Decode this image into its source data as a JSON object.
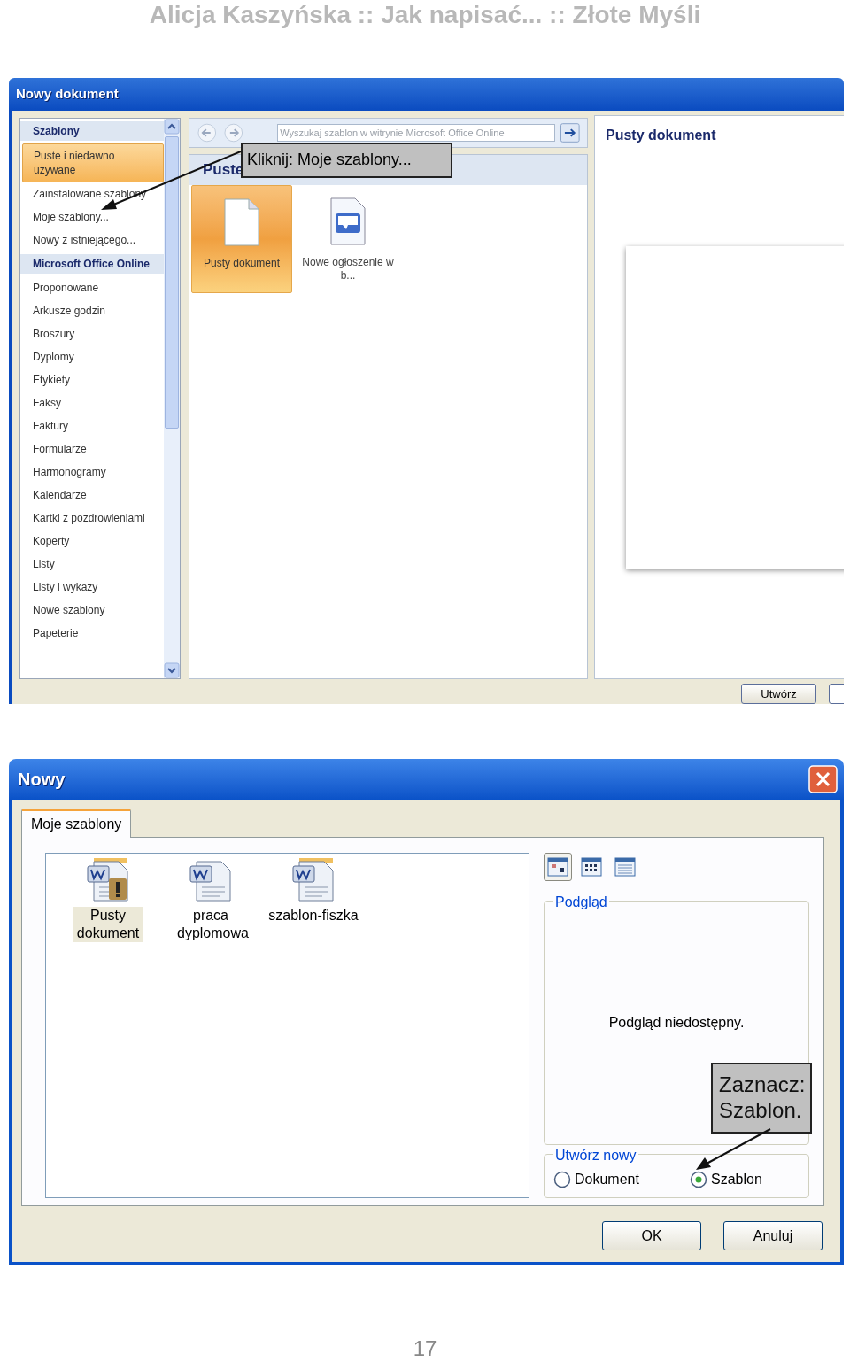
{
  "page_header": "Alicja Kaszyńska :: Jak napisać... :: Złote Myśli",
  "screenshot_1": {
    "window": {
      "title": "Nowy dokument"
    },
    "sidebar": {
      "items": [
        {
          "label": "Szablony",
          "kind": "header"
        },
        {
          "label": "Puste i niedawno używane",
          "kind": "item",
          "selected": true
        },
        {
          "label": "Zainstalowane szablony",
          "kind": "item",
          "selected": false
        },
        {
          "label": "Moje szablony...",
          "kind": "item",
          "selected": false
        },
        {
          "label": "Nowy z istniejącego...",
          "kind": "item",
          "selected": false
        },
        {
          "label": "Microsoft Office Online",
          "kind": "header"
        },
        {
          "label": "Proponowane",
          "kind": "item",
          "selected": false
        },
        {
          "label": "Arkusze godzin",
          "kind": "item",
          "selected": false
        },
        {
          "label": "Broszury",
          "kind": "item",
          "selected": false
        },
        {
          "label": "Dyplomy",
          "kind": "item",
          "selected": false
        },
        {
          "label": "Etykiety",
          "kind": "item",
          "selected": false
        },
        {
          "label": "Faksy",
          "kind": "item",
          "selected": false
        },
        {
          "label": "Faktury",
          "kind": "item",
          "selected": false
        },
        {
          "label": "Formularze",
          "kind": "item",
          "selected": false
        },
        {
          "label": "Harmonogramy",
          "kind": "item",
          "selected": false
        },
        {
          "label": "Kalendarze",
          "kind": "item",
          "selected": false
        },
        {
          "label": "Kartki z pozdrowieniami",
          "kind": "item",
          "selected": false
        },
        {
          "label": "Koperty",
          "kind": "item",
          "selected": false
        },
        {
          "label": "Listy",
          "kind": "item",
          "selected": false
        },
        {
          "label": "Listy i wykazy",
          "kind": "item",
          "selected": false
        },
        {
          "label": "Nowe szablony",
          "kind": "item",
          "selected": false
        },
        {
          "label": "Papeterie",
          "kind": "item",
          "selected": false
        }
      ]
    },
    "search": {
      "placeholder": "Wyszukaj szablon w witrynie Microsoft Office Online"
    },
    "section_title": "Puste",
    "templates": [
      {
        "label": "Pusty dokument",
        "kind": "blank",
        "selected": true
      },
      {
        "label": "Nowe ogłoszenie w b...",
        "kind": "announcement",
        "selected": false
      }
    ],
    "preview": {
      "title": "Pusty dokument"
    },
    "buttons": [
      "Utwórz"
    ],
    "callout": "Kliknij: Moje szablony..."
  },
  "screenshot_2": {
    "window": {
      "title": "Nowy"
    },
    "tabs": [
      {
        "label": "Moje szablony",
        "selected": true
      }
    ],
    "files": [
      {
        "label": "Pusty dokument",
        "kind": "warning",
        "selected": true
      },
      {
        "label": "praca dyplomowa",
        "kind": "document",
        "selected": false
      },
      {
        "label": "szablon-fiszka",
        "kind": "template",
        "selected": false
      }
    ],
    "view_buttons": [
      {
        "kind": "large",
        "selected": true
      },
      {
        "kind": "small",
        "selected": false
      },
      {
        "kind": "details",
        "selected": false
      }
    ],
    "preview": {
      "title": "Podgląd",
      "message": "Podgląd niedostępny."
    },
    "create_new": {
      "title": "Utwórz nowy",
      "options": [
        {
          "label": "Dokument",
          "selected": false
        },
        {
          "label": "Szablon",
          "selected": true
        }
      ]
    },
    "buttons": [
      "OK",
      "Anuluj"
    ],
    "callout": "Zaznacz: Szablon."
  },
  "page_number": "17"
}
